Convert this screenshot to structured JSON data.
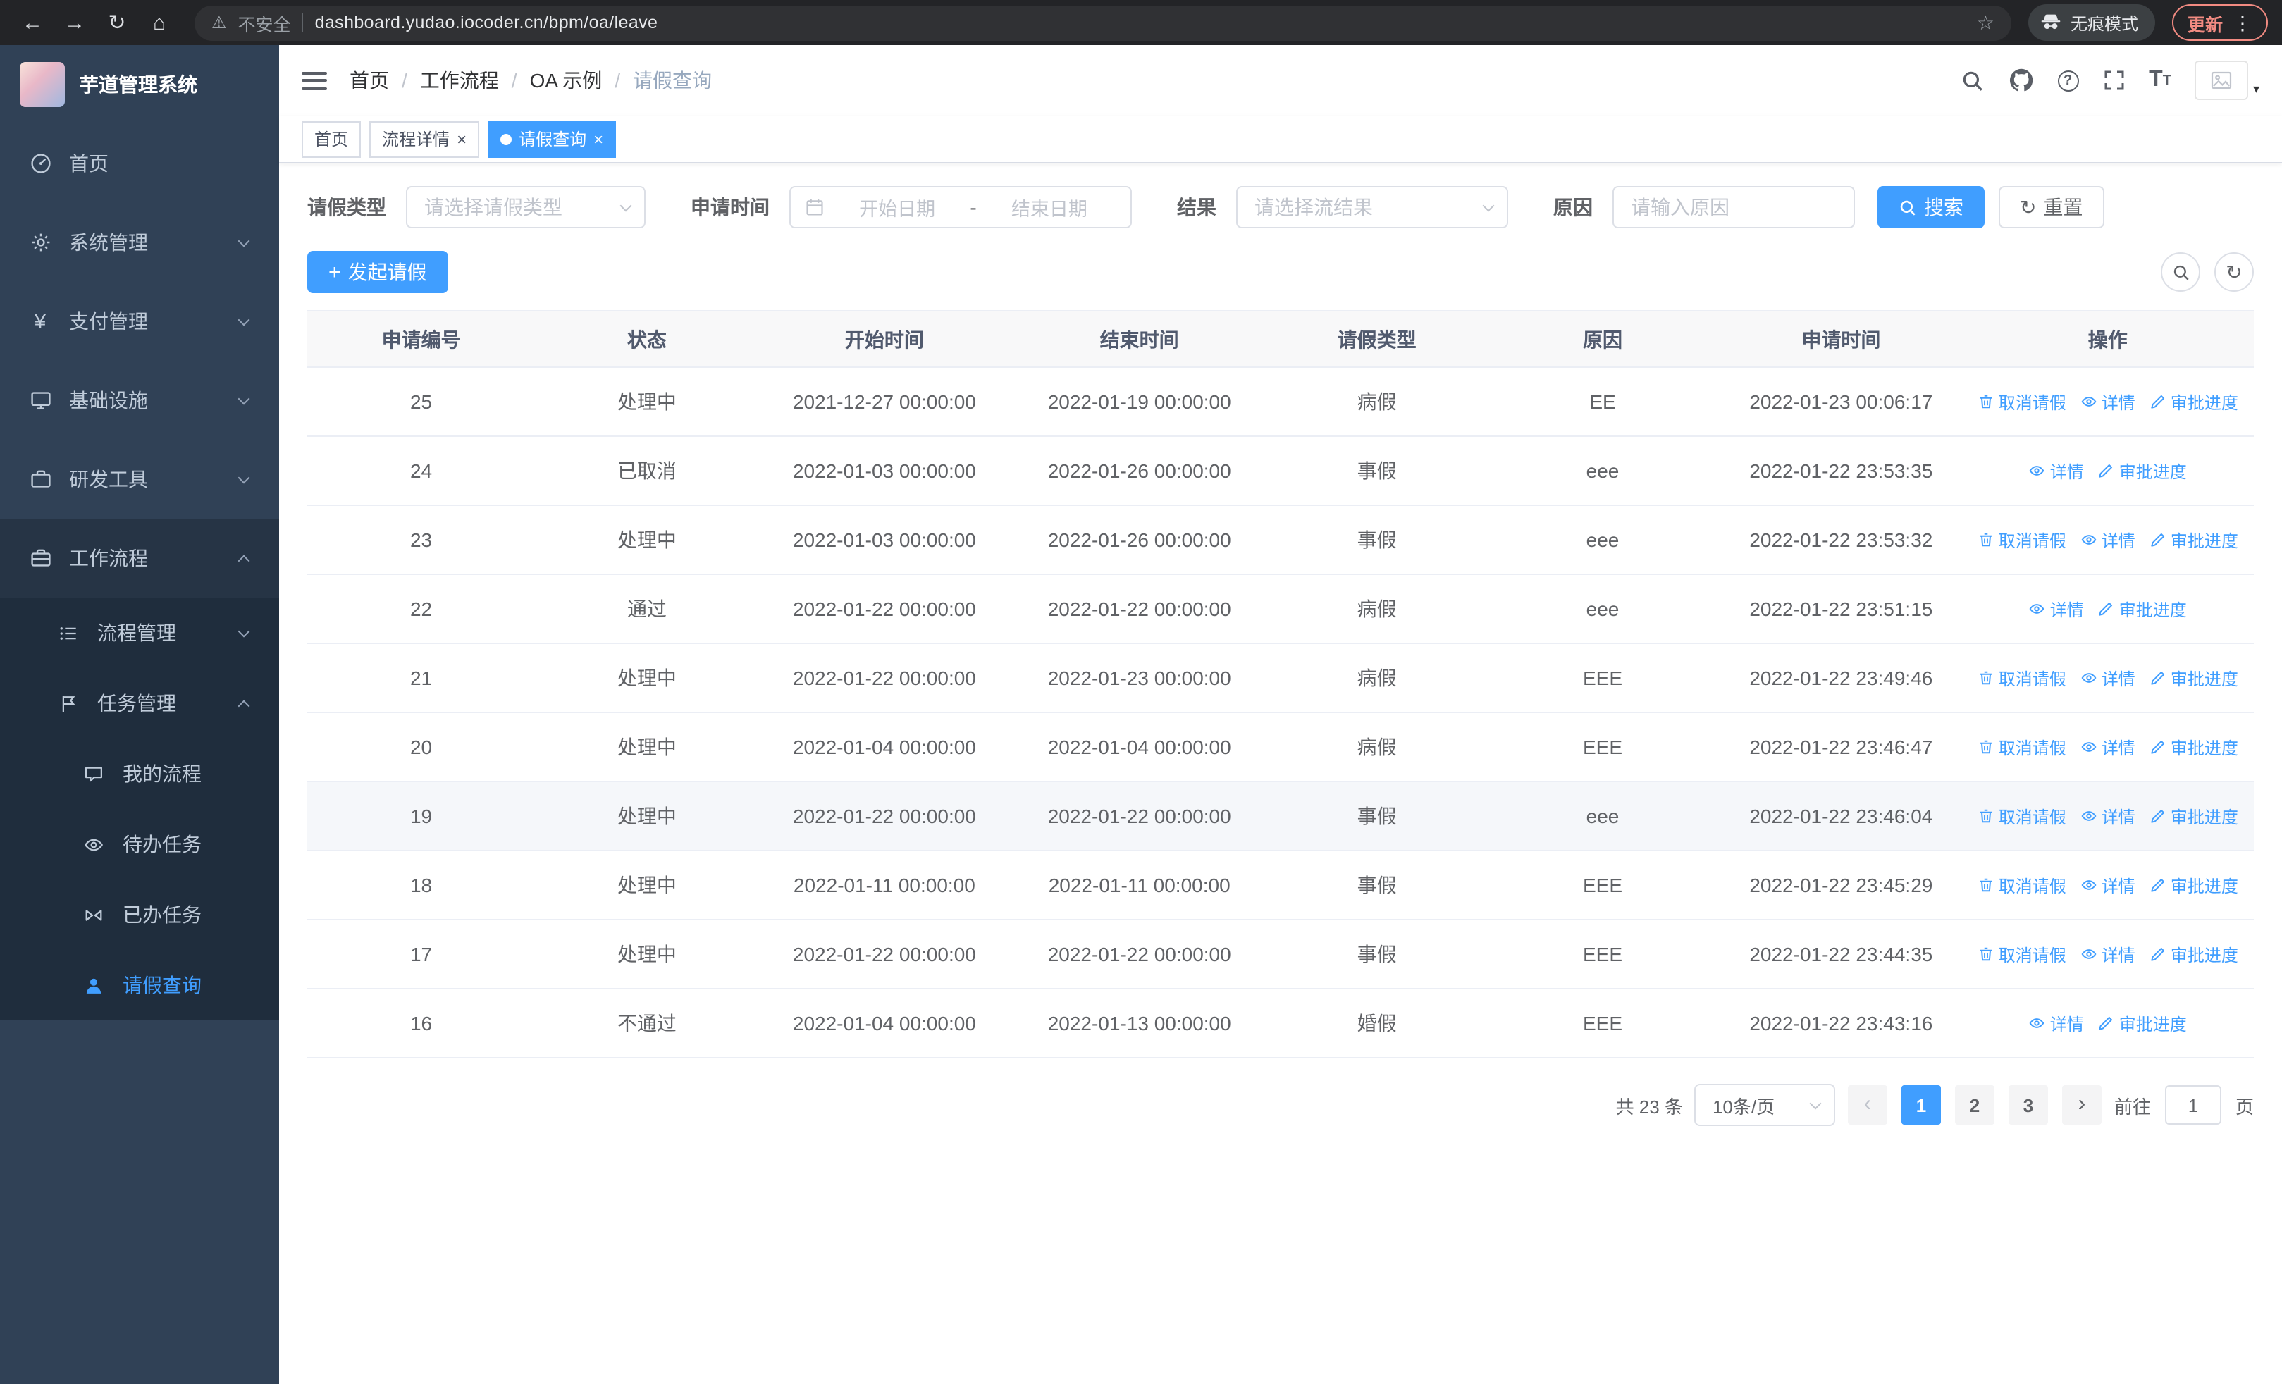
{
  "browser": {
    "security_text": "不安全",
    "url": "dashboard.yudao.iocoder.cn/bpm/oa/leave",
    "incognito_label": "无痕模式",
    "update_label": "更新"
  },
  "sidebar": {
    "title": "芋道管理系统",
    "menu": [
      {
        "label": "首页"
      },
      {
        "label": "系统管理"
      },
      {
        "label": "支付管理"
      },
      {
        "label": "基础设施"
      },
      {
        "label": "研发工具"
      },
      {
        "label": "工作流程"
      }
    ],
    "workflow_children": [
      {
        "label": "流程管理"
      },
      {
        "label": "任务管理"
      }
    ],
    "task_children": [
      {
        "label": "我的流程"
      },
      {
        "label": "待办任务"
      },
      {
        "label": "已办任务"
      },
      {
        "label": "请假查询"
      }
    ]
  },
  "navbar": {
    "breadcrumb": [
      "首页",
      "工作流程",
      "OA 示例",
      "请假查询"
    ],
    "separator": "/"
  },
  "tabs": [
    {
      "label": "首页"
    },
    {
      "label": "流程详情"
    },
    {
      "label": "请假查询"
    }
  ],
  "filters": {
    "leave_type_label": "请假类型",
    "leave_type_placeholder": "请选择请假类型",
    "apply_time_label": "申请时间",
    "start_date_placeholder": "开始日期",
    "date_separator": "-",
    "end_date_placeholder": "结束日期",
    "result_label": "结果",
    "result_placeholder": "请选择流结果",
    "reason_label": "原因",
    "reason_placeholder": "请输入原因",
    "search_button": "搜索",
    "reset_button": "重置"
  },
  "toolbar": {
    "create_button": "发起请假"
  },
  "table": {
    "columns": [
      "申请编号",
      "状态",
      "开始时间",
      "结束时间",
      "请假类型",
      "原因",
      "申请时间",
      "操作"
    ],
    "action_labels": {
      "cancel": "取消请假",
      "detail": "详情",
      "progress": "审批进度"
    },
    "action_icons": {
      "cancel": "trash-icon",
      "detail": "eye-icon",
      "progress": "edit-icon"
    },
    "rows": [
      {
        "id": "25",
        "status": "处理中",
        "start": "2021-12-27 00:00:00",
        "end": "2022-01-19 00:00:00",
        "type": "病假",
        "reason": "EE",
        "applied": "2022-01-23 00:06:17",
        "actions": [
          "cancel",
          "detail",
          "progress"
        ],
        "hover": false
      },
      {
        "id": "24",
        "status": "已取消",
        "start": "2022-01-03 00:00:00",
        "end": "2022-01-26 00:00:00",
        "type": "事假",
        "reason": "eee",
        "applied": "2022-01-22 23:53:35",
        "actions": [
          "detail",
          "progress"
        ],
        "hover": false
      },
      {
        "id": "23",
        "status": "处理中",
        "start": "2022-01-03 00:00:00",
        "end": "2022-01-26 00:00:00",
        "type": "事假",
        "reason": "eee",
        "applied": "2022-01-22 23:53:32",
        "actions": [
          "cancel",
          "detail",
          "progress"
        ],
        "hover": false
      },
      {
        "id": "22",
        "status": "通过",
        "start": "2022-01-22 00:00:00",
        "end": "2022-01-22 00:00:00",
        "type": "病假",
        "reason": "eee",
        "applied": "2022-01-22 23:51:15",
        "actions": [
          "detail",
          "progress"
        ],
        "hover": false
      },
      {
        "id": "21",
        "status": "处理中",
        "start": "2022-01-22 00:00:00",
        "end": "2022-01-23 00:00:00",
        "type": "病假",
        "reason": "EEE",
        "applied": "2022-01-22 23:49:46",
        "actions": [
          "cancel",
          "detail",
          "progress"
        ],
        "hover": false
      },
      {
        "id": "20",
        "status": "处理中",
        "start": "2022-01-04 00:00:00",
        "end": "2022-01-04 00:00:00",
        "type": "病假",
        "reason": "EEE",
        "applied": "2022-01-22 23:46:47",
        "actions": [
          "cancel",
          "detail",
          "progress"
        ],
        "hover": false
      },
      {
        "id": "19",
        "status": "处理中",
        "start": "2022-01-22 00:00:00",
        "end": "2022-01-22 00:00:00",
        "type": "事假",
        "reason": "eee",
        "applied": "2022-01-22 23:46:04",
        "actions": [
          "cancel",
          "detail",
          "progress"
        ],
        "hover": true
      },
      {
        "id": "18",
        "status": "处理中",
        "start": "2022-01-11 00:00:00",
        "end": "2022-01-11 00:00:00",
        "type": "事假",
        "reason": "EEE",
        "applied": "2022-01-22 23:45:29",
        "actions": [
          "cancel",
          "detail",
          "progress"
        ],
        "hover": false
      },
      {
        "id": "17",
        "status": "处理中",
        "start": "2022-01-22 00:00:00",
        "end": "2022-01-22 00:00:00",
        "type": "事假",
        "reason": "EEE",
        "applied": "2022-01-22 23:44:35",
        "actions": [
          "cancel",
          "detail",
          "progress"
        ],
        "hover": false
      },
      {
        "id": "16",
        "status": "不通过",
        "start": "2022-01-04 00:00:00",
        "end": "2022-01-13 00:00:00",
        "type": "婚假",
        "reason": "EEE",
        "applied": "2022-01-22 23:43:16",
        "actions": [
          "detail",
          "progress"
        ],
        "hover": false
      }
    ]
  },
  "pagination": {
    "total_text": "共 23 条",
    "page_size": "10条/页",
    "pages": [
      "1",
      "2",
      "3"
    ],
    "active_page": "1",
    "goto_prefix": "前往",
    "goto_value": "1",
    "goto_suffix": "页"
  },
  "colors": {
    "primary": "#409eff",
    "sidebar_bg": "#304156",
    "submenu_bg": "#1f2d3d"
  }
}
